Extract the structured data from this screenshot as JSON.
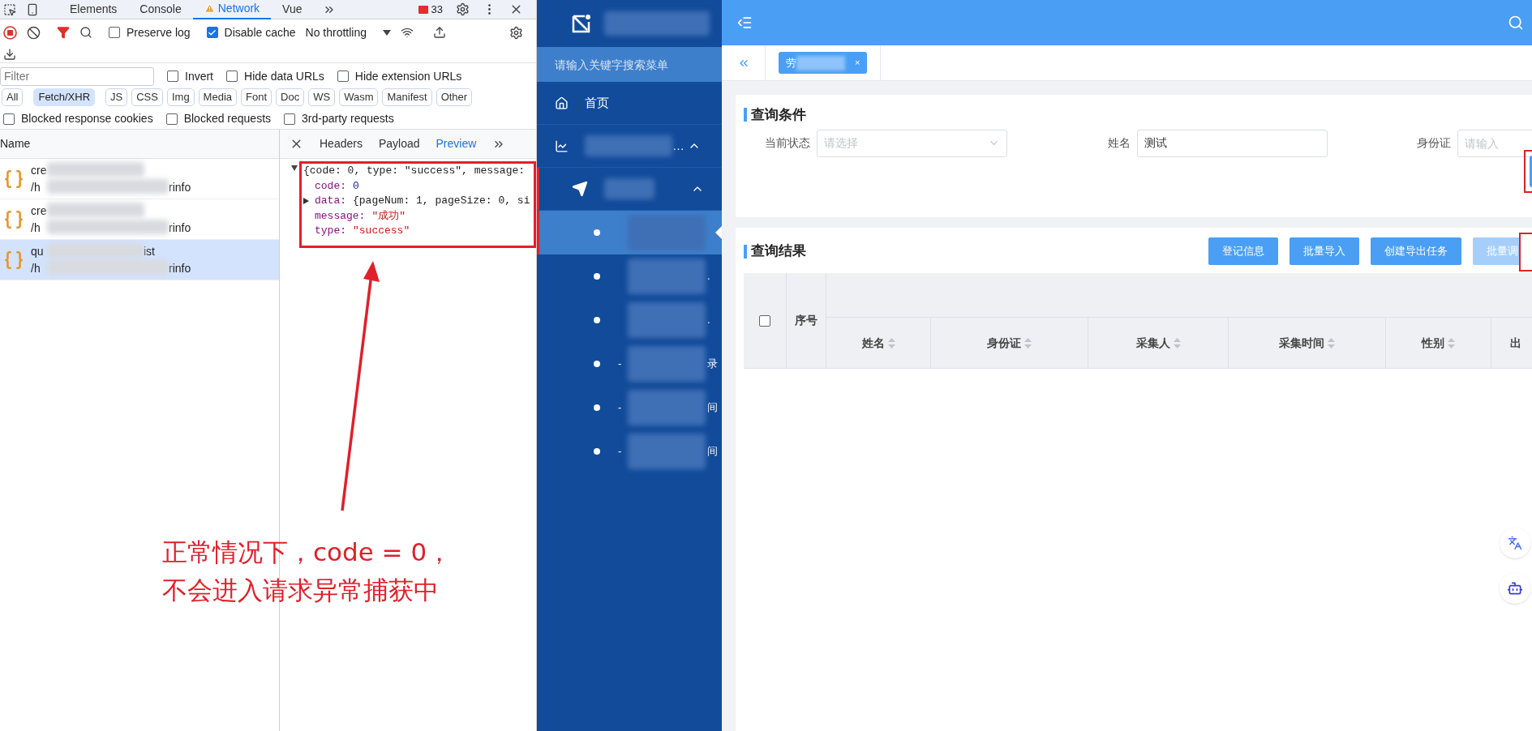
{
  "devtools": {
    "tabs": [
      {
        "label": "Elements",
        "selected": false,
        "warning": false
      },
      {
        "label": "Console",
        "selected": false,
        "warning": false
      },
      {
        "label": "Network",
        "selected": true,
        "warning": true
      },
      {
        "label": "Vue",
        "selected": false,
        "warning": false
      }
    ],
    "error_count": "33",
    "preserve_log": {
      "label": "Preserve log",
      "checked": false
    },
    "disable_cache": {
      "label": "Disable cache",
      "checked": true
    },
    "throttling": "No throttling",
    "filter": {
      "placeholder": "Filter"
    },
    "filter_options": [
      {
        "label": "Invert",
        "checked": false
      },
      {
        "label": "Hide data URLs",
        "checked": false
      },
      {
        "label": "Hide extension URLs",
        "checked": false
      }
    ],
    "type_filters": [
      {
        "label": "All",
        "selected": false
      },
      {
        "label": "Fetch/XHR",
        "selected": true
      },
      {
        "label": "JS",
        "selected": false
      },
      {
        "label": "CSS",
        "selected": false
      },
      {
        "label": "Img",
        "selected": false
      },
      {
        "label": "Media",
        "selected": false
      },
      {
        "label": "Font",
        "selected": false
      },
      {
        "label": "Doc",
        "selected": false
      },
      {
        "label": "WS",
        "selected": false
      },
      {
        "label": "Wasm",
        "selected": false
      },
      {
        "label": "Manifest",
        "selected": false
      },
      {
        "label": "Other",
        "selected": false
      }
    ],
    "blocked_options": [
      {
        "label": "Blocked response cookies",
        "checked": false
      },
      {
        "label": "Blocked requests",
        "checked": false
      },
      {
        "label": "3rd-party requests",
        "checked": false
      }
    ],
    "requests": {
      "header": "Name",
      "rows": [
        {
          "name": "cre",
          "path": "/h",
          "path_end": "rinfo",
          "selected": false
        },
        {
          "name": "cre",
          "path": "/h",
          "path_end": "rinfo",
          "selected": false
        },
        {
          "name": "qu",
          "name_end": "ist",
          "path": "/h",
          "path_end": "rinfo",
          "selected": true
        }
      ]
    },
    "detail_tabs": [
      {
        "label": "Headers",
        "selected": false
      },
      {
        "label": "Payload",
        "selected": false
      },
      {
        "label": "Preview",
        "selected": true
      }
    ],
    "preview": {
      "summary": "{code: 0, type: \"success\", message:",
      "expanded": true,
      "fields": [
        {
          "key": "code:",
          "value": "0",
          "kind": "number"
        },
        {
          "key": "data:",
          "value": "{pageNum: 1, pageSize: 0, si",
          "kind": "object",
          "expanded": false
        },
        {
          "key": "message:",
          "value": "\"成功\"",
          "kind": "string"
        },
        {
          "key": "type:",
          "value": "\"success\"",
          "kind": "string"
        }
      ]
    }
  },
  "annotation": {
    "lines": [
      "正常情况下，code = 0，",
      "不会进入请求异常捕获中"
    ]
  },
  "sidebar": {
    "search": {
      "placeholder": "请输入关键字搜索菜单"
    },
    "items": [
      {
        "label": "首页",
        "kind": "home"
      },
      {
        "label": "…",
        "kind": "chart",
        "expanded": true
      },
      {
        "kind": "send",
        "expanded": true,
        "children": [
          {
            "selected": true
          },
          {
            "end": ".",
            "selected": false
          },
          {
            "end": ".",
            "selected": false
          },
          {
            "start": "-",
            "end": "录",
            "selected": false
          },
          {
            "start": "-",
            "end": "间",
            "selected": false
          },
          {
            "start": "-",
            "end": "间",
            "selected": false
          }
        ]
      }
    ]
  },
  "tab_bar": {
    "tabs": [
      {
        "label": "劳",
        "selected": true,
        "close": "×"
      }
    ]
  },
  "query": {
    "title": "查询条件",
    "fields": [
      {
        "label": "当前状态",
        "kind": "select",
        "placeholder": "请选择"
      },
      {
        "label": "姓名",
        "kind": "input",
        "value": "测试"
      },
      {
        "label": "身份证",
        "kind": "input",
        "placeholder": "请输入"
      }
    ]
  },
  "results": {
    "title": "查询结果",
    "buttons": [
      {
        "label": "登记信息",
        "disabled": false
      },
      {
        "label": "批量导入",
        "disabled": false
      },
      {
        "label": "创建导出任务",
        "disabled": false
      },
      {
        "label": "批量调",
        "disabled": true
      }
    ],
    "table": {
      "select_all": {
        "checked": false
      },
      "columns": [
        {
          "label": "序号",
          "sortable": false
        },
        {
          "label": "姓名",
          "sortable": true
        },
        {
          "label": "身份证",
          "sortable": true
        },
        {
          "label": "采集人",
          "sortable": true
        },
        {
          "label": "采集时间",
          "sortable": true
        },
        {
          "label": "性别",
          "sortable": true
        },
        {
          "label": "出",
          "sortable": false
        }
      ]
    }
  }
}
